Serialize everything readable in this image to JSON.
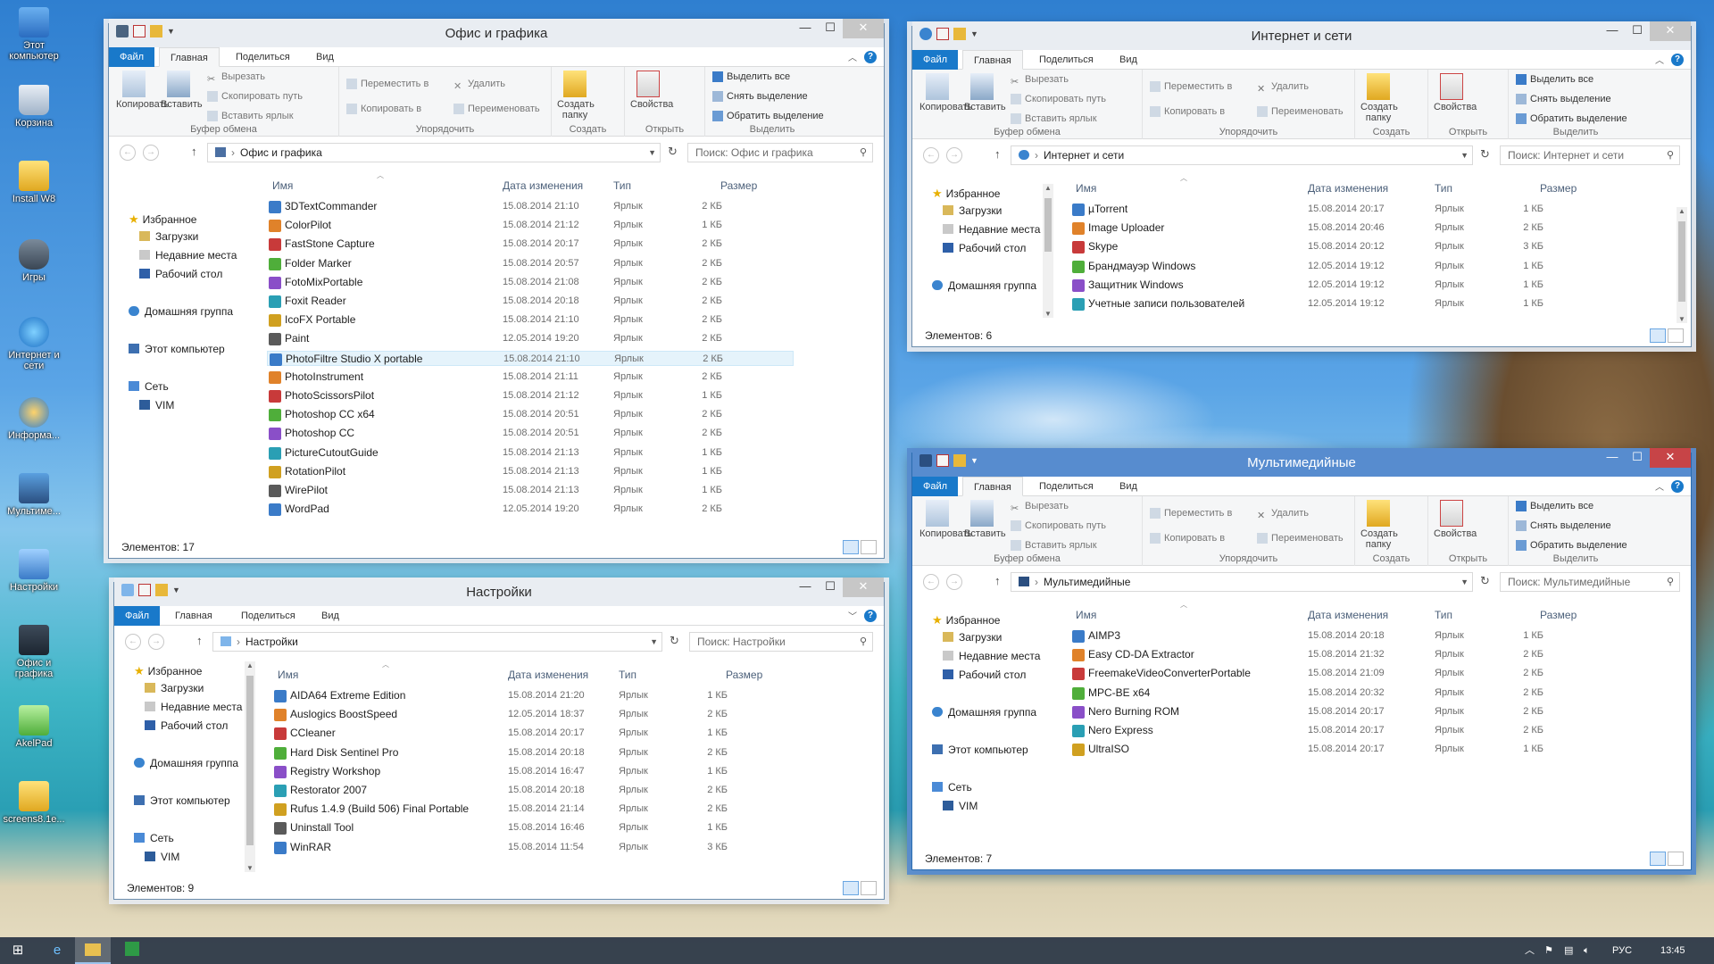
{
  "desktop": {
    "icons": [
      {
        "label": "Этот компьютер",
        "icon": "computer-icon"
      },
      {
        "label": "Корзина",
        "icon": "recycle-bin-icon"
      },
      {
        "label": "Install W8",
        "icon": "folder-icon"
      },
      {
        "label": "Игры",
        "icon": "gamepad-icon"
      },
      {
        "label": "Интернет и сети",
        "icon": "globe-icon"
      },
      {
        "label": "Информа...",
        "icon": "info-icon"
      },
      {
        "label": "Мультиме...",
        "icon": "multimedia-icon"
      },
      {
        "label": "Настройки",
        "icon": "settings-icon"
      },
      {
        "label": "Офис и графика",
        "icon": "office-icon"
      },
      {
        "label": "AkelPad",
        "icon": "notepad-icon"
      },
      {
        "label": "screens8.1e...",
        "icon": "folder-icon"
      }
    ]
  },
  "ribbon": {
    "tabs": {
      "file": "Файл",
      "home": "Главная",
      "share": "Поделиться",
      "view": "Вид"
    },
    "copy": "Копировать",
    "paste": "Вставить",
    "cut": "Вырезать",
    "copy_path": "Скопировать путь",
    "paste_shortcut": "Вставить ярлык",
    "clipboard": "Буфер обмена",
    "move_to": "Переместить в",
    "copy_to": "Копировать в",
    "delete": "Удалить",
    "rename": "Переименовать",
    "organize": "Упорядочить",
    "new_folder": "Создать папку",
    "create": "Создать",
    "properties": "Свойства",
    "open": "Открыть",
    "select_all": "Выделить все",
    "select_none": "Снять выделение",
    "invert": "Обратить выделение",
    "select": "Выделить"
  },
  "headers": {
    "name": "Имя",
    "date": "Дата изменения",
    "type": "Тип",
    "size": "Размер"
  },
  "nav": {
    "favorites": "Избранное",
    "downloads": "Загрузки",
    "recent": "Недавние места",
    "desktop": "Рабочий стол",
    "homegroup": "Домашняя группа",
    "computer": "Этот компьютер",
    "network": "Сеть",
    "vim": "VIM"
  },
  "windows": {
    "office": {
      "title": "Офис и графика",
      "address": "Офис и графика",
      "search_placeholder": "Поиск: Офис и графика",
      "status": "Элементов: 17",
      "files": [
        {
          "name": "3DTextCommander",
          "date": "15.08.2014 21:10",
          "type": "Ярлык",
          "size": "2 КБ"
        },
        {
          "name": "ColorPilot",
          "date": "15.08.2014 21:12",
          "type": "Ярлык",
          "size": "1 КБ"
        },
        {
          "name": "FastStone Capture",
          "date": "15.08.2014 20:17",
          "type": "Ярлык",
          "size": "2 КБ"
        },
        {
          "name": "Folder Marker",
          "date": "15.08.2014 20:57",
          "type": "Ярлык",
          "size": "2 КБ"
        },
        {
          "name": "FotoMixPortable",
          "date": "15.08.2014 21:08",
          "type": "Ярлык",
          "size": "2 КБ"
        },
        {
          "name": "Foxit Reader",
          "date": "15.08.2014 20:18",
          "type": "Ярлык",
          "size": "2 КБ"
        },
        {
          "name": "IcoFX Portable",
          "date": "15.08.2014 21:10",
          "type": "Ярлык",
          "size": "2 КБ"
        },
        {
          "name": "Paint",
          "date": "12.05.2014 19:20",
          "type": "Ярлык",
          "size": "2 КБ"
        },
        {
          "name": "PhotoFiltre Studio X portable",
          "date": "15.08.2014 21:10",
          "type": "Ярлык",
          "size": "2 КБ"
        },
        {
          "name": "PhotoInstrument",
          "date": "15.08.2014 21:11",
          "type": "Ярлык",
          "size": "2 КБ"
        },
        {
          "name": "PhotoScissorsPilot",
          "date": "15.08.2014 21:12",
          "type": "Ярлык",
          "size": "1 КБ"
        },
        {
          "name": "Photoshop CC x64",
          "date": "15.08.2014 20:51",
          "type": "Ярлык",
          "size": "2 КБ"
        },
        {
          "name": "Photoshop CC",
          "date": "15.08.2014 20:51",
          "type": "Ярлык",
          "size": "2 КБ"
        },
        {
          "name": "PictureCutoutGuide",
          "date": "15.08.2014 21:13",
          "type": "Ярлык",
          "size": "1 КБ"
        },
        {
          "name": "RotationPilot",
          "date": "15.08.2014 21:13",
          "type": "Ярлык",
          "size": "1 КБ"
        },
        {
          "name": "WirePilot",
          "date": "15.08.2014 21:13",
          "type": "Ярлык",
          "size": "1 КБ"
        },
        {
          "name": "WordPad",
          "date": "12.05.2014 19:20",
          "type": "Ярлык",
          "size": "2 КБ"
        }
      ]
    },
    "internet": {
      "title": "Интернет и сети",
      "address": "Интернет и сети",
      "search_placeholder": "Поиск: Интернет и сети",
      "status": "Элементов: 6",
      "files": [
        {
          "name": "µTorrent",
          "date": "15.08.2014 20:17",
          "type": "Ярлык",
          "size": "1 КБ"
        },
        {
          "name": "Image Uploader",
          "date": "15.08.2014 20:46",
          "type": "Ярлык",
          "size": "2 КБ"
        },
        {
          "name": "Skype",
          "date": "15.08.2014 20:12",
          "type": "Ярлык",
          "size": "3 КБ"
        },
        {
          "name": "Брандмауэр Windows",
          "date": "12.05.2014 19:12",
          "type": "Ярлык",
          "size": "1 КБ"
        },
        {
          "name": "Защитник Windows",
          "date": "12.05.2014 19:12",
          "type": "Ярлык",
          "size": "1 КБ"
        },
        {
          "name": "Учетные записи пользователей",
          "date": "12.05.2014 19:12",
          "type": "Ярлык",
          "size": "1 КБ"
        }
      ]
    },
    "settings": {
      "title": "Настройки",
      "address": "Настройки",
      "search_placeholder": "Поиск: Настройки",
      "status": "Элементов: 9",
      "files": [
        {
          "name": "AIDA64 Extreme Edition",
          "date": "15.08.2014 21:20",
          "type": "Ярлык",
          "size": "1 КБ"
        },
        {
          "name": "Auslogics BoostSpeed",
          "date": "12.05.2014 18:37",
          "type": "Ярлык",
          "size": "2 КБ"
        },
        {
          "name": "CCleaner",
          "date": "15.08.2014 20:17",
          "type": "Ярлык",
          "size": "1 КБ"
        },
        {
          "name": "Hard Disk Sentinel Pro",
          "date": "15.08.2014 20:18",
          "type": "Ярлык",
          "size": "2 КБ"
        },
        {
          "name": "Registry Workshop",
          "date": "15.08.2014 16:47",
          "type": "Ярлык",
          "size": "1 КБ"
        },
        {
          "name": "Restorator 2007",
          "date": "15.08.2014 20:18",
          "type": "Ярлык",
          "size": "2 КБ"
        },
        {
          "name": "Rufus 1.4.9 (Build 506) Final Portable",
          "date": "15.08.2014 21:14",
          "type": "Ярлык",
          "size": "2 КБ"
        },
        {
          "name": "Uninstall Tool",
          "date": "15.08.2014 16:46",
          "type": "Ярлык",
          "size": "1 КБ"
        },
        {
          "name": "WinRAR",
          "date": "15.08.2014 11:54",
          "type": "Ярлык",
          "size": "3 КБ"
        }
      ]
    },
    "multimedia": {
      "title": "Мультимедийные",
      "address": "Мультимедийные",
      "search_placeholder": "Поиск: Мультимедийные",
      "status": "Элементов: 7",
      "files": [
        {
          "name": "AIMP3",
          "date": "15.08.2014 20:18",
          "type": "Ярлык",
          "size": "1 КБ"
        },
        {
          "name": "Easy CD-DA Extractor",
          "date": "15.08.2014 21:32",
          "type": "Ярлык",
          "size": "2 КБ"
        },
        {
          "name": "FreemakeVideoConverterPortable",
          "date": "15.08.2014 21:09",
          "type": "Ярлык",
          "size": "2 КБ"
        },
        {
          "name": "MPC-BE x64",
          "date": "15.08.2014 20:32",
          "type": "Ярлык",
          "size": "2 КБ"
        },
        {
          "name": "Nero Burning ROM",
          "date": "15.08.2014 20:17",
          "type": "Ярлык",
          "size": "2 КБ"
        },
        {
          "name": "Nero Express",
          "date": "15.08.2014 20:17",
          "type": "Ярлык",
          "size": "2 КБ"
        },
        {
          "name": "UltraISO",
          "date": "15.08.2014 20:17",
          "type": "Ярлык",
          "size": "1 КБ"
        }
      ]
    }
  },
  "taskbar": {
    "lang": "РУС",
    "time": "13:45"
  }
}
